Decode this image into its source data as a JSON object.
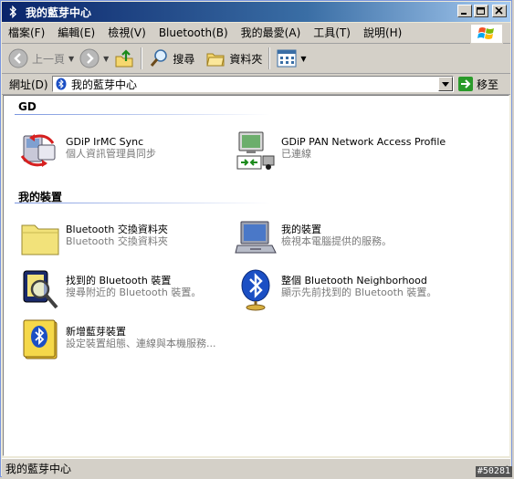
{
  "window": {
    "title": "我的藍芽中心"
  },
  "menu": {
    "items": [
      {
        "label": "檔案(F)"
      },
      {
        "label": "編輯(E)"
      },
      {
        "label": "檢視(V)"
      },
      {
        "label": "Bluetooth(B)"
      },
      {
        "label": "我的最愛(A)"
      },
      {
        "label": "工具(T)"
      },
      {
        "label": "說明(H)"
      }
    ]
  },
  "toolbar": {
    "back_label": "上一頁",
    "search_label": "搜尋",
    "folders_label": "資料夾"
  },
  "address": {
    "label": "網址(D)",
    "value": "我的藍芽中心",
    "go_label": "移至"
  },
  "groups": [
    {
      "header": "GD",
      "items": [
        {
          "title": "GDiP IrMC Sync",
          "subtitle": "個人資訊管理員同步",
          "icon": "pim-sync-icon"
        },
        {
          "title": "GDiP PAN Network Access Profile",
          "subtitle": "已連線",
          "icon": "network-access-icon"
        }
      ]
    },
    {
      "header": "我的裝置",
      "items": [
        {
          "title": "Bluetooth 交換資料夾",
          "subtitle": "Bluetooth 交換資料夾",
          "icon": "folder-icon"
        },
        {
          "title": "我的裝置",
          "subtitle": "檢視本電腦提供的服務。",
          "icon": "laptop-icon"
        },
        {
          "title": "找到的 Bluetooth 裝置",
          "subtitle": "搜尋附近的 Bluetooth 裝置。",
          "icon": "device-search-icon"
        },
        {
          "title": "整個 Bluetooth Neighborhood",
          "subtitle": "顯示先前找到的 Bluetooth 裝置。",
          "icon": "bluetooth-globe-icon"
        },
        {
          "title": "新增藍芽裝置",
          "subtitle": "設定裝置組態、連線與本機服務...",
          "icon": "add-bluetooth-device-icon"
        }
      ]
    }
  ],
  "status": {
    "text": "我的藍芽中心"
  },
  "watermark": "#50281",
  "colors": {
    "title_start": "#0a246a",
    "title_end": "#a6caf0",
    "bluetooth_blue": "#1b4fc4"
  }
}
